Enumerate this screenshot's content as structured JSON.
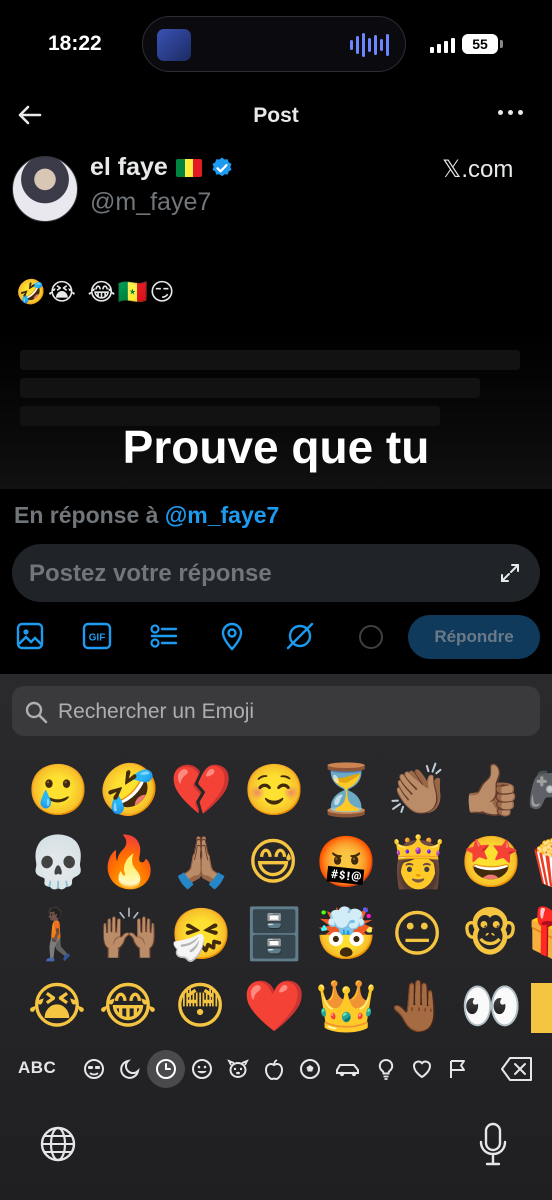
{
  "status_bar": {
    "time": "18:22",
    "battery": "55"
  },
  "header": {
    "title": "Post"
  },
  "post": {
    "author_name": "el faye",
    "handle": "@m_faye7",
    "source": "𝕏.com",
    "text": "🤣😭   😂🇸🇳😏",
    "media_caption": "Prouve que tu"
  },
  "reply": {
    "in_reply_prefix": "En réponse à",
    "in_reply_handle": "@m_faye7",
    "placeholder": "Postez votre réponse",
    "button_label": "Répondre"
  },
  "toolbar_icons": [
    "image-icon",
    "gif-icon",
    "poll-icon",
    "location-icon",
    "grok-icon"
  ],
  "keyboard": {
    "search_placeholder": "Rechercher un Emoji",
    "emoji_rows": [
      [
        "🥲",
        "🤣",
        "💔",
        "☺️",
        "⏳",
        "👏🏽",
        "👍🏽",
        "🎮"
      ],
      [
        "💀",
        "🔥",
        "🙏🏽",
        "😅",
        "🤬",
        "👸",
        "🤩",
        "🍿"
      ],
      [
        "🚶🏿",
        "🙌🏽",
        "🤧",
        "🗄️",
        "🤯",
        "😐",
        "🐵",
        "🎁"
      ],
      [
        "😭",
        "😂",
        "😳",
        "❤️",
        "👑",
        "🤚🏾",
        "👀",
        "🏿"
      ]
    ],
    "abc_label": "ABC",
    "categories": [
      "smileys-people-icon",
      "moon-icon",
      "recent-clock-icon",
      "emoji-face-icon",
      "animal-icon",
      "food-apple-icon",
      "soccer-ball-icon",
      "car-icon",
      "lightbulb-icon",
      "heart-icon",
      "flag-icon"
    ]
  },
  "colors": {
    "accent": "#1d9bf0",
    "background": "#000000",
    "keyboard": "#2a2a2c"
  }
}
